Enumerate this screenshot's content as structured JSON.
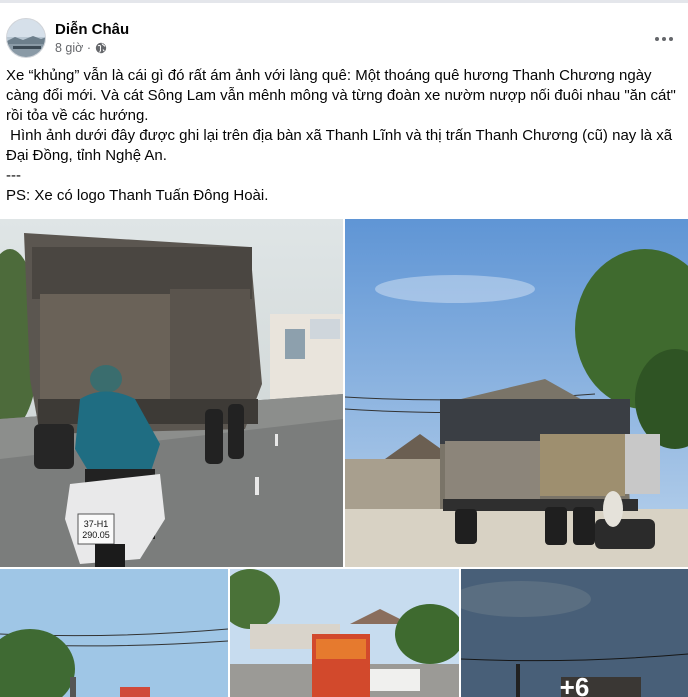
{
  "post": {
    "author": "Diễn Châu",
    "time": "8 giờ ·",
    "privacy_icon": "globe-icon",
    "more_icon": "more-options-icon",
    "text": [
      "Xe “khủng” vẫn là cái gì đó rất ám ảnh với làng quê: Một thoáng quê hương Thanh Chương ngày càng đổi mới. Và cát Sông Lam vẫn mênh mông và từng đoàn xe nườm nượp nối đuôi nhau \"ăn cát\" rồi tỏa về các hướng.",
      " Hình ảnh dưới đây được ghi lại trên địa bàn xã Thanh Lĩnh và thị trấn Thanh Chương (cũ) nay là xã Đại Đồng, tỉnh Nghệ An.",
      "---",
      "PS: Xe có logo Thanh Tuấn Đông Hoài."
    ]
  },
  "photos": {
    "plate_line1": "37-H1",
    "plate_line2": "290.05",
    "extra_count": "+6"
  },
  "colors": {
    "text_primary": "#050505",
    "text_secondary": "#65676b",
    "divider": "#e4e6eb"
  }
}
